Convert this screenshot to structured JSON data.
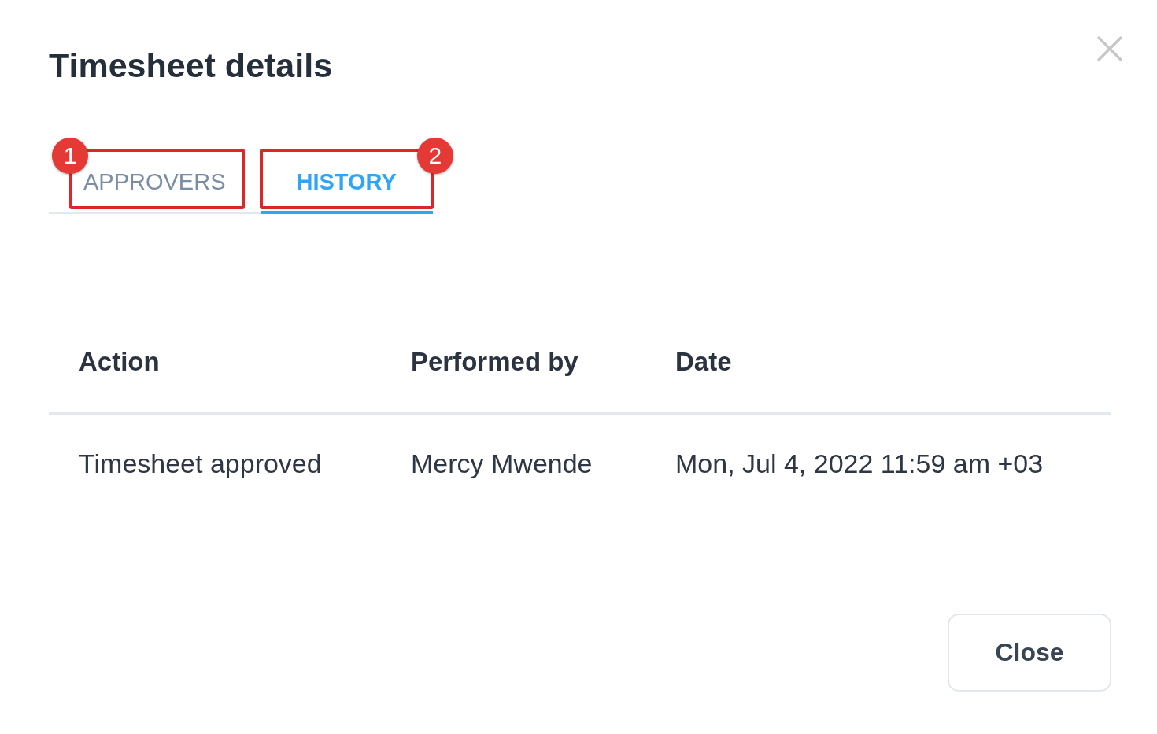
{
  "dialog": {
    "title": "Timesheet details",
    "tabs": [
      {
        "label": "APPROVERS",
        "selected": false,
        "callout": "1"
      },
      {
        "label": "HISTORY",
        "selected": true,
        "callout": "2"
      }
    ],
    "table": {
      "columns": [
        "Action",
        "Performed by",
        "Date"
      ],
      "rows": [
        [
          "Timesheet approved",
          "Mercy Mwende",
          "Mon, Jul 4, 2022 11:59 am +03"
        ]
      ]
    },
    "buttons": [
      "Close"
    ]
  }
}
